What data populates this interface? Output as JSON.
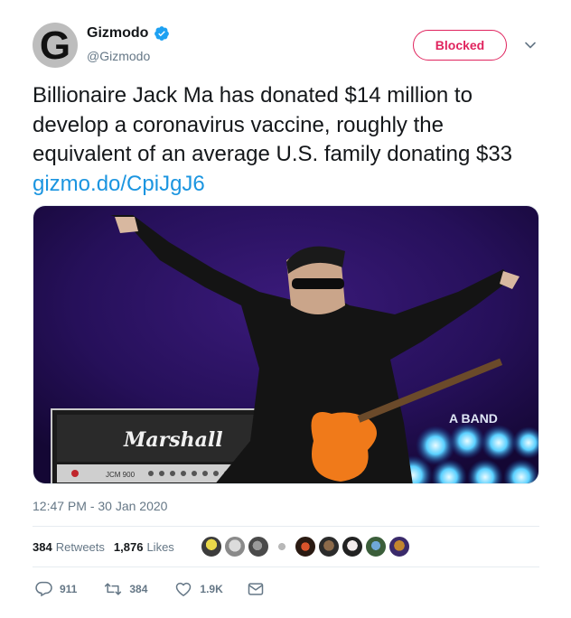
{
  "author": {
    "display_name": "Gizmodo",
    "handle": "@Gizmodo",
    "avatar_letter": "G",
    "verified_icon": "verified-badge-icon"
  },
  "follow_button": {
    "label": "Blocked",
    "color": "#e0245e"
  },
  "menu_icon": "chevron-down-icon",
  "tweet": {
    "text": "Billionaire Jack Ma has donated $14 million to develop a coronavirus vaccine, roughly the equivalent of an average U.S. family donating $33 ",
    "link": "gizmo.do/CpiJgJ6",
    "link_color": "#1b95e0"
  },
  "media": {
    "amp_brand": "Marshall",
    "banner_text": "A BAND",
    "amp_model": "JCM 900"
  },
  "timestamp": "12:47 PM - 30 Jan 2020",
  "stats": {
    "retweets_count": "384",
    "retweets_label": "Retweets",
    "likes_count": "1,876",
    "likes_label": "Likes"
  },
  "actions": {
    "reply_count": "911",
    "retweet_count": "384",
    "like_count": "1.9K"
  },
  "colors": {
    "muted": "#657786",
    "text": "#14171a",
    "accent": "#1b95e0",
    "divider": "#e6ecf0"
  }
}
